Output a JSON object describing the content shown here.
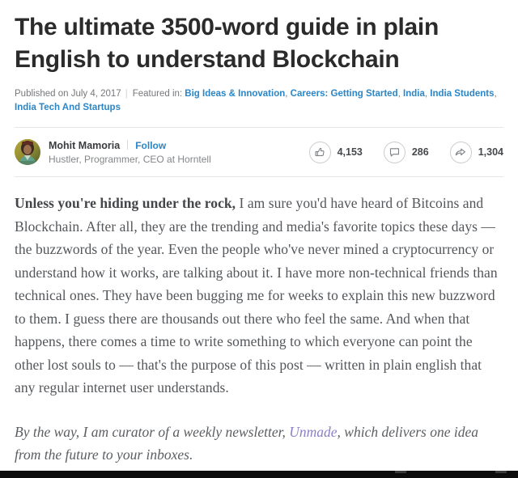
{
  "article": {
    "title": "The ultimate 3500-word guide in plain English to understand Blockchain",
    "meta": {
      "published": "Published on July 4, 2017",
      "featured_label": "Featured in:",
      "tags": [
        "Big Ideas & Innovation",
        "Careers: Getting Started",
        "India",
        "India Students",
        "India Tech And Startups"
      ]
    },
    "author": {
      "name": "Mohit Mamoria",
      "follow_label": "Follow",
      "headline": "Hustler, Programmer, CEO at Horntell",
      "avatar_alt": "avatar"
    },
    "stats": [
      {
        "icon": "thumbs-up-icon",
        "name": "likes",
        "count": "4,153"
      },
      {
        "icon": "comment-icon",
        "name": "comments",
        "count": "286"
      },
      {
        "icon": "share-arrow-icon",
        "name": "shares",
        "count": "1,304"
      }
    ],
    "body": {
      "lead_in": "Unless you're hiding under the rock,",
      "paragraph1_rest": " I am sure you'd have heard of Bitcoins and Blockchain. After all, they are the trending and media's favorite topics these days — the buzzwords of the year. Even the people who've never mined a cryptocurrency or understand how it works, are talking about it. I have more non-technical friends than technical ones. They have been bugging me for weeks to explain this new buzzword to them. I guess there are thousands out there who feel the same. And when that happens, there comes a time to write something to which everyone can point the other lost souls to — that's the purpose of this post — written in plain english that any regular internet user understands.",
      "newsletter_prefix": "By the way, I am curator of a weekly newsletter, ",
      "newsletter_link": "Unmade",
      "newsletter_suffix": ", which delivers one idea from the future to your inboxes."
    }
  },
  "colors": {
    "link_blue": "#2a86c8",
    "link_purple": "#8a7fc4",
    "title": "#2b2b2b",
    "body_text": "#53565a",
    "meta_text": "#76777a",
    "rule": "#e6e6e6"
  }
}
